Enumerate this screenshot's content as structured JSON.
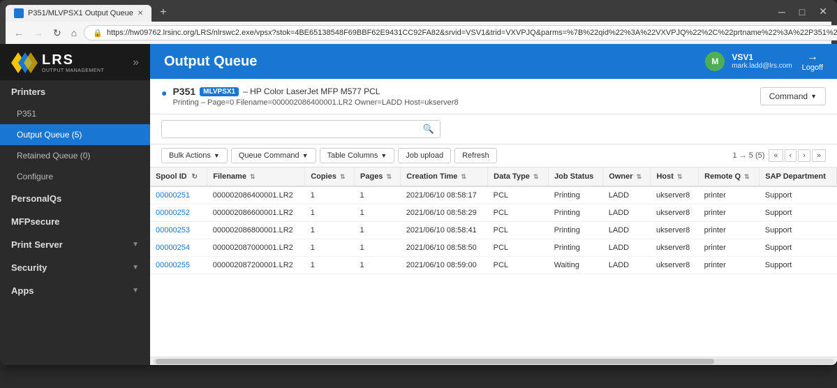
{
  "browser": {
    "tab_title": "P351/MLVPSX1 Output Queue",
    "tab_favicon": "P",
    "url": "https://hw09762.lrsinc.org/LRS/nlrswc2.exe/vpsx?stok=4BE65138548F69BBF62E9431CC92FA82&srvid=VSV1&trid=VXVPJQ&parms=%7B%22qid%22%3A%22VXVPJQ%22%2C%22prtname%22%3A%22P351%22%2C...",
    "nav": {
      "back": "←",
      "forward": "→",
      "refresh": "↻",
      "home": "⌂"
    }
  },
  "sidebar": {
    "logo": {
      "lrs": "LRS",
      "sub": "OUTPUT MANAGEMENT"
    },
    "items": [
      {
        "label": "Printers",
        "level": "section",
        "active": false
      },
      {
        "label": "P351",
        "level": "sub",
        "active": false
      },
      {
        "label": "Output Queue (5)",
        "level": "sub",
        "active": true
      },
      {
        "label": "Retained Queue (0)",
        "level": "sub",
        "active": false
      },
      {
        "label": "Configure",
        "level": "sub",
        "active": false
      },
      {
        "label": "PersonalQs",
        "level": "section",
        "active": false
      },
      {
        "label": "MFPsecure",
        "level": "section",
        "active": false
      },
      {
        "label": "Print Server",
        "level": "section",
        "active": false,
        "has_chevron": true
      },
      {
        "label": "Security",
        "level": "section",
        "active": false,
        "has_chevron": true
      },
      {
        "label": "Apps",
        "level": "section",
        "active": false,
        "has_chevron": true
      }
    ]
  },
  "header": {
    "title": "Output Queue",
    "user": {
      "vsv": "VSV1",
      "email": "mark.ladd@lrs.com",
      "logoff": "Logoff",
      "initials": "M"
    }
  },
  "printer_info": {
    "name": "P351",
    "badge": "MLVPSX1",
    "model": "– HP Color LaserJet MFP M577 PCL",
    "status": "Printing – Page=0 Filename=000002086400001.LR2 Owner=LADD Host=ukserver8",
    "command_btn": "Command"
  },
  "toolbar": {
    "search_placeholder": "",
    "bulk_actions": "Bulk Actions",
    "queue_command": "Queue Command",
    "table_columns": "Table Columns",
    "job_upload": "Job upload",
    "refresh": "Refresh",
    "pagination_info": "1 → 5 (5)",
    "first": "«",
    "prev": "‹",
    "next": "›",
    "last": "»"
  },
  "table": {
    "columns": [
      {
        "label": "Spool ID",
        "sortable": false,
        "has_refresh": true
      },
      {
        "label": "Filename",
        "sortable": true
      },
      {
        "label": "Copies",
        "sortable": true
      },
      {
        "label": "Pages",
        "sortable": true
      },
      {
        "label": "Creation Time",
        "sortable": true
      },
      {
        "label": "Data Type",
        "sortable": true
      },
      {
        "label": "Job Status",
        "sortable": false
      },
      {
        "label": "Owner",
        "sortable": true
      },
      {
        "label": "Host",
        "sortable": true
      },
      {
        "label": "Remote Q",
        "sortable": true
      },
      {
        "label": "SAP Department",
        "sortable": false
      }
    ],
    "rows": [
      {
        "spool_id": "00000251",
        "filename": "000002086400001.LR2",
        "copies": "1",
        "pages": "1",
        "creation_time": "2021/06/10 08:58:17",
        "data_type": "PCL",
        "job_status": "Printing",
        "owner": "LADD",
        "host": "ukserver8",
        "remote_q": "printer",
        "sap_dept": "Support"
      },
      {
        "spool_id": "00000252",
        "filename": "000002086600001.LR2",
        "copies": "1",
        "pages": "1",
        "creation_time": "2021/06/10 08:58:29",
        "data_type": "PCL",
        "job_status": "Printing",
        "owner": "LADD",
        "host": "ukserver8",
        "remote_q": "printer",
        "sap_dept": "Support"
      },
      {
        "spool_id": "00000253",
        "filename": "000002086800001.LR2",
        "copies": "1",
        "pages": "1",
        "creation_time": "2021/06/10 08:58:41",
        "data_type": "PCL",
        "job_status": "Printing",
        "owner": "LADD",
        "host": "ukserver8",
        "remote_q": "printer",
        "sap_dept": "Support"
      },
      {
        "spool_id": "00000254",
        "filename": "000002087000001.LR2",
        "copies": "1",
        "pages": "1",
        "creation_time": "2021/06/10 08:58:50",
        "data_type": "PCL",
        "job_status": "Printing",
        "owner": "LADD",
        "host": "ukserver8",
        "remote_q": "printer",
        "sap_dept": "Support"
      },
      {
        "spool_id": "00000255",
        "filename": "000002087200001.LR2",
        "copies": "1",
        "pages": "1",
        "creation_time": "2021/06/10 08:59:00",
        "data_type": "PCL",
        "job_status": "Waiting",
        "owner": "LADD",
        "host": "ukserver8",
        "remote_q": "printer",
        "sap_dept": "Support"
      }
    ]
  },
  "colors": {
    "brand_blue": "#1976d2",
    "sidebar_bg": "#2b2b2b",
    "active_nav": "#1976d2"
  }
}
